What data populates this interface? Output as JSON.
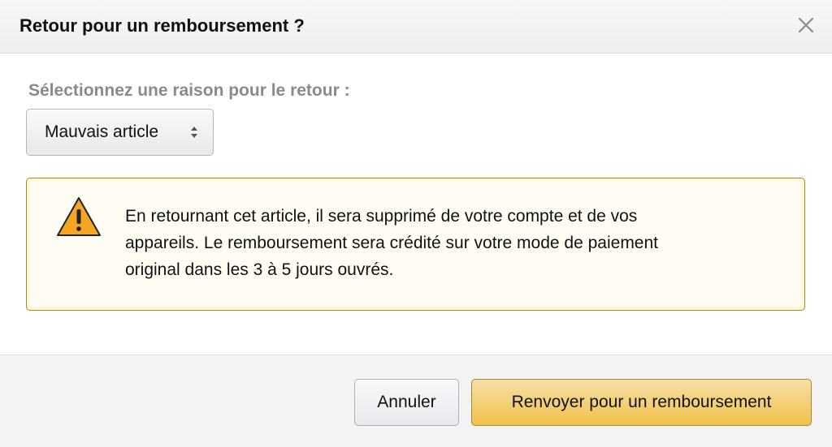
{
  "dialog": {
    "title": "Retour pour un remboursement ?",
    "close_icon": "close-icon"
  },
  "form": {
    "reason_label": "Sélectionnez une raison pour le retour :",
    "reason_select": {
      "selected": "Mauvais article",
      "icon": "select-arrows-icon"
    }
  },
  "alert": {
    "icon": "warning-icon",
    "lines": [
      "En retournant cet article, il sera supprimé de votre compte et de vos",
      "appareils. Le remboursement sera crédité sur votre mode de paiement",
      "original dans les 3 à 5 jours ouvrés."
    ],
    "border_color": "#a98a12",
    "icon_color": "#f5a623"
  },
  "footer": {
    "cancel_label": "Annuler",
    "submit_label": "Renvoyer pour un remboursement",
    "primary_color": "#f0c14b"
  }
}
